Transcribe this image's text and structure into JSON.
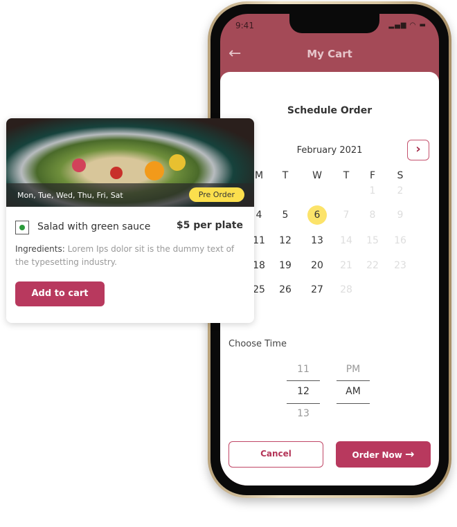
{
  "phone": {
    "status_time": "9:41",
    "status_icons": "signal wifi battery",
    "header": {
      "title": "My Cart",
      "back_icon": "arrow-left-icon"
    }
  },
  "schedule": {
    "title": "Schedule Order",
    "month": "February 2021",
    "next_icon": "chevron-right-icon",
    "weekdays": [
      "M",
      "T",
      "W",
      "T",
      "F",
      "S"
    ],
    "rows": [
      [
        null,
        null,
        null,
        null,
        {
          "d": "1",
          "off": true
        },
        {
          "d": "2",
          "off": true
        }
      ],
      [
        {
          "d": "4"
        },
        {
          "d": "5"
        },
        {
          "d": "6",
          "sel": true
        },
        {
          "d": "7",
          "off": true
        },
        {
          "d": "8",
          "off": true
        },
        {
          "d": "9",
          "off": true
        }
      ],
      [
        {
          "d": "11"
        },
        {
          "d": "12"
        },
        {
          "d": "13"
        },
        {
          "d": "14",
          "off": true
        },
        {
          "d": "15",
          "off": true
        },
        {
          "d": "16",
          "off": true
        }
      ],
      [
        {
          "d": "18"
        },
        {
          "d": "19"
        },
        {
          "d": "20"
        },
        {
          "d": "21",
          "off": true
        },
        {
          "d": "22",
          "off": true
        },
        {
          "d": "23",
          "off": true
        }
      ],
      [
        {
          "d": "25"
        },
        {
          "d": "26"
        },
        {
          "d": "27"
        },
        {
          "d": "28",
          "off": true
        },
        null,
        null
      ]
    ],
    "selected_color": "#fce36a",
    "choose_time": "Choose Time",
    "hours": [
      "11",
      "12",
      "13"
    ],
    "meridiem": [
      "PM",
      "AM"
    ],
    "cancel": "Cancel",
    "order_now": "Order Now",
    "accent": "#b8395e"
  },
  "card": {
    "days": "Mon, Tue, Wed, Thu, Fri, Sat",
    "badge": "Pre Order",
    "name": "Salad with green sauce",
    "price": "$5 per plate",
    "ingredients_label": "Ingredients:",
    "ingredients": " Lorem Ips dolor sit is the dummy text of the typesetting industry.",
    "add": "Add to cart"
  }
}
